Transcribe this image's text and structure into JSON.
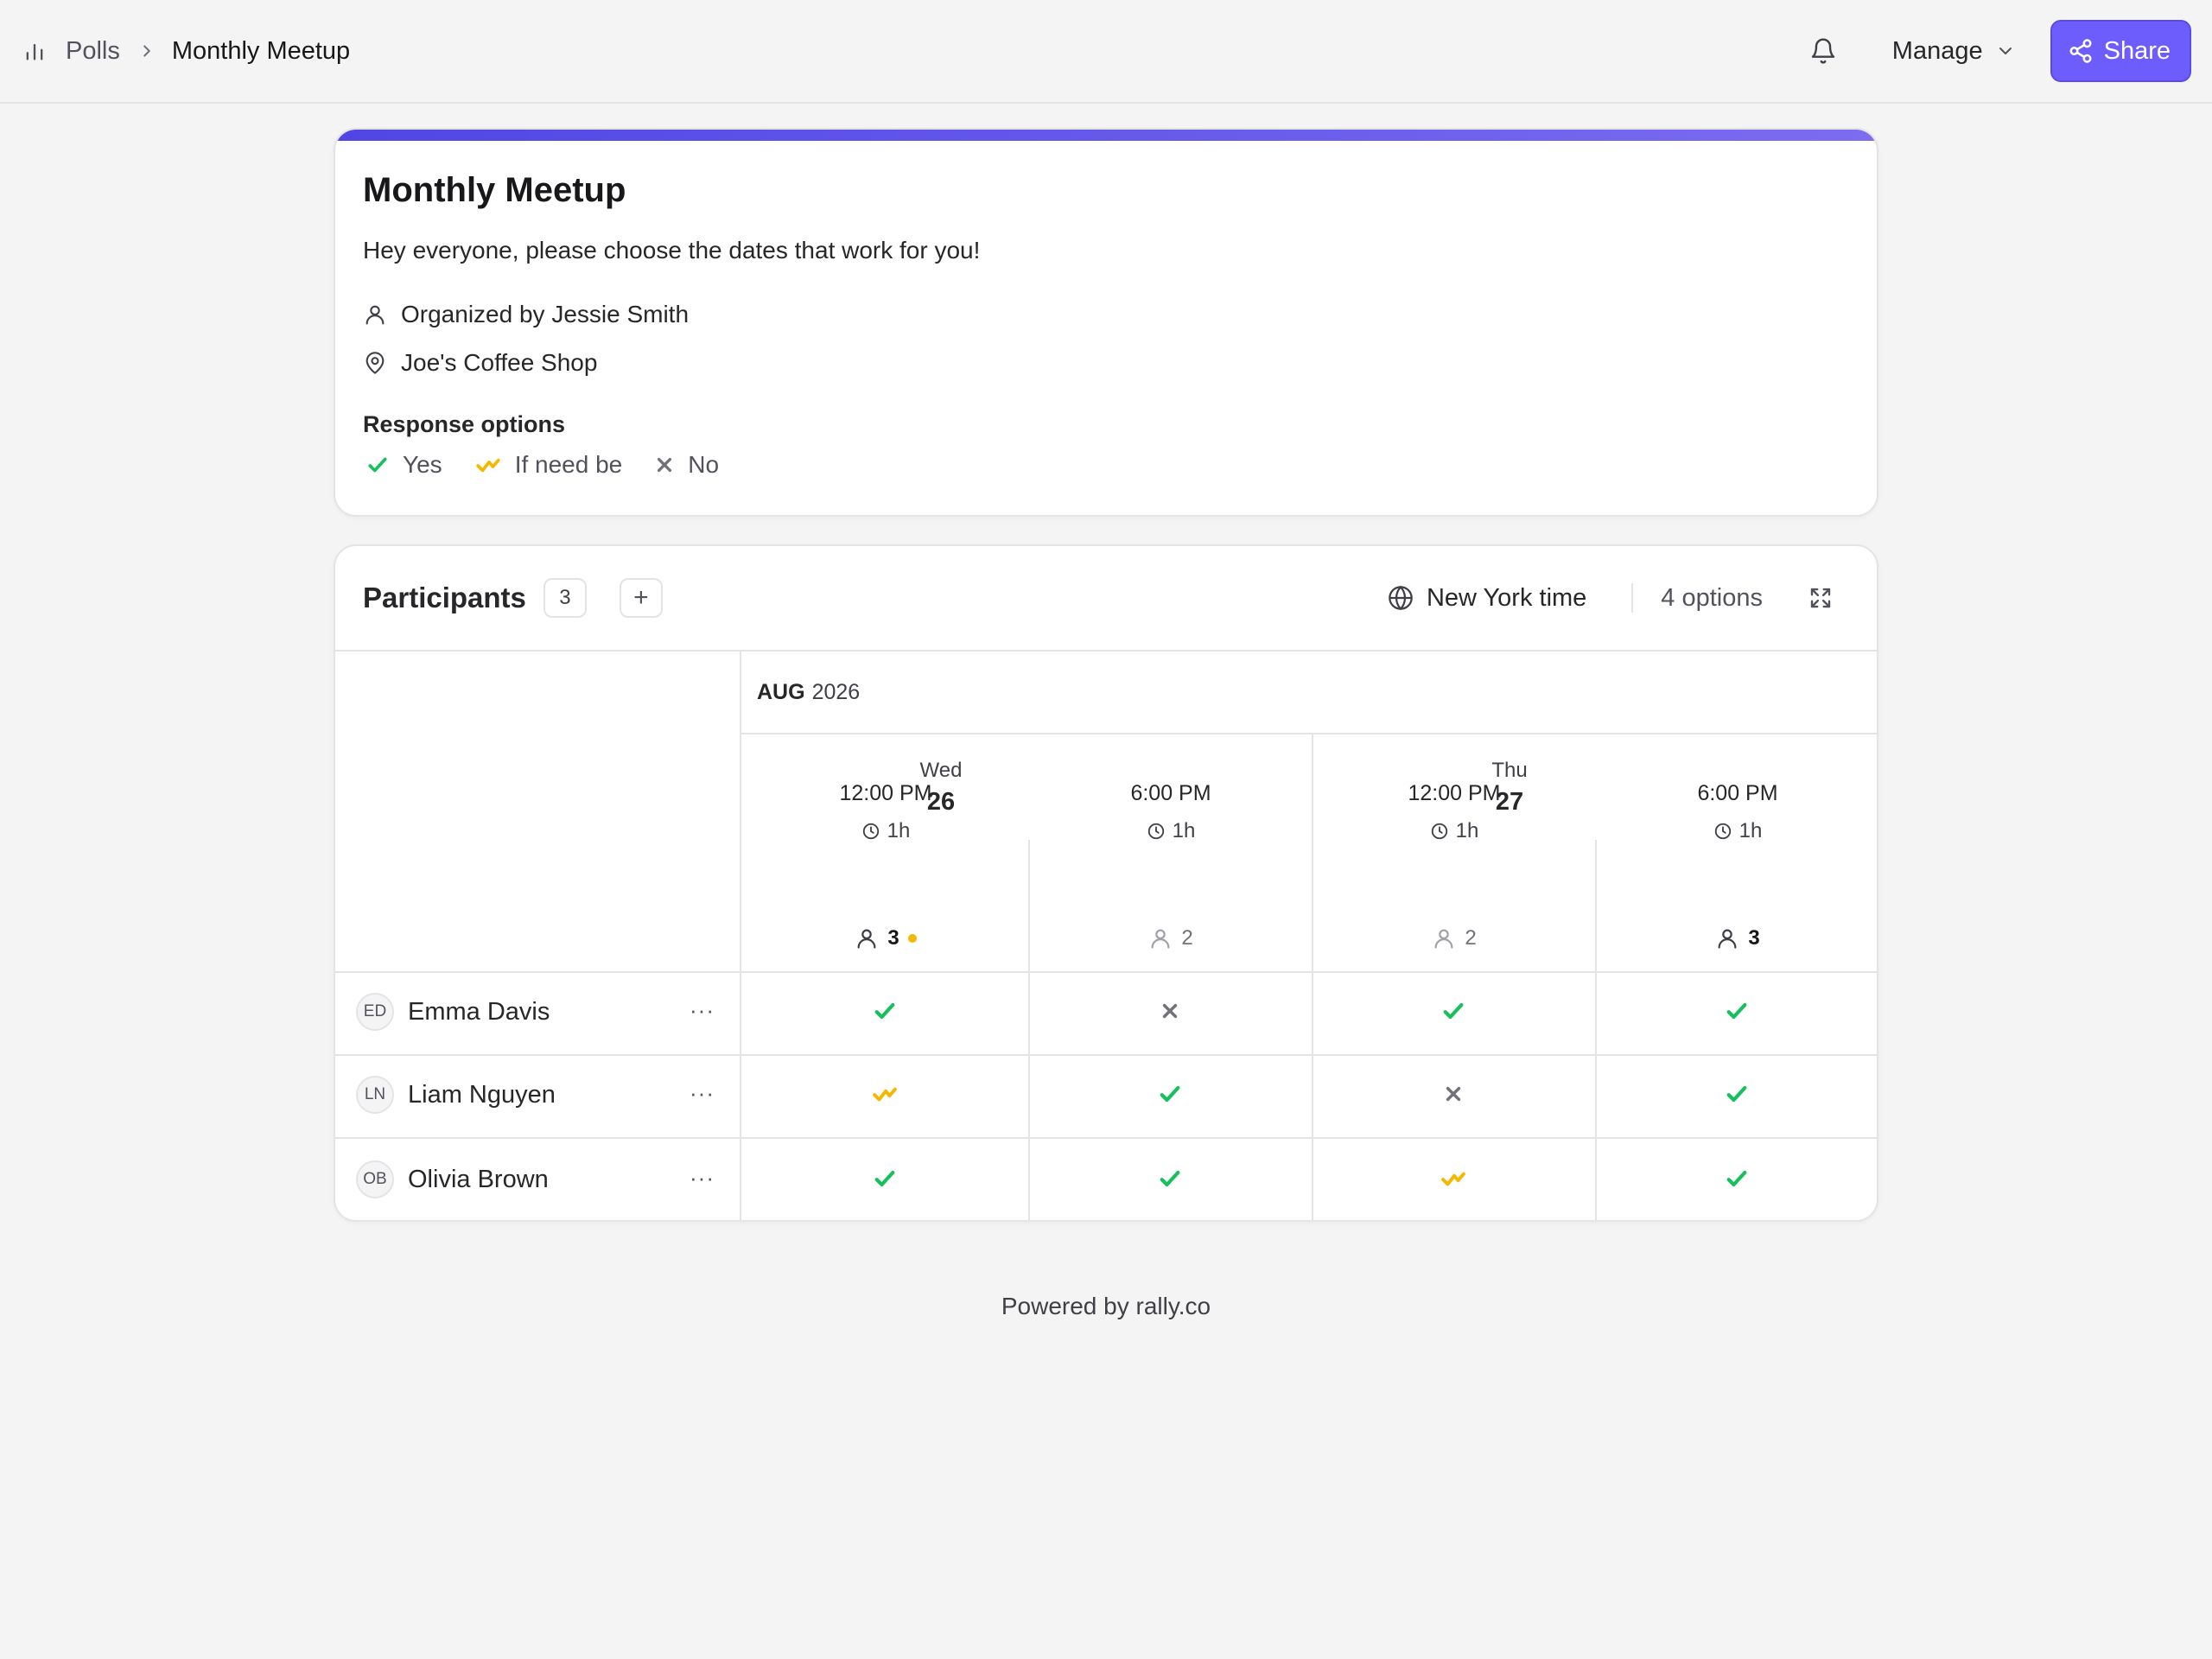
{
  "breadcrumb": {
    "root": "Polls",
    "current": "Monthly Meetup"
  },
  "header": {
    "manage_label": "Manage",
    "share_label": "Share"
  },
  "poll": {
    "title": "Monthly Meetup",
    "description": "Hey everyone, please choose the dates that work for you!",
    "organizer": "Organized by Jessie Smith",
    "location": "Joe's Coffee Shop"
  },
  "response_options": {
    "heading": "Response options",
    "yes": "Yes",
    "if_need_be": "If need be",
    "no": "No"
  },
  "participants": {
    "heading": "Participants",
    "count": "3",
    "add_label": "+",
    "timezone": "New York time",
    "options_count": "4 options"
  },
  "grid": {
    "month": "AUG",
    "year": "2026",
    "dates": [
      {
        "dow": "Wed",
        "day": "26"
      },
      {
        "dow": "Thu",
        "day": "27"
      }
    ],
    "columns": [
      {
        "time": "12:00 PM",
        "duration": "1h",
        "votes": "3"
      },
      {
        "time": "6:00 PM",
        "duration": "1h",
        "votes": "2"
      },
      {
        "time": "12:00 PM",
        "duration": "1h",
        "votes": "2"
      },
      {
        "time": "6:00 PM",
        "duration": "1h",
        "votes": "3"
      }
    ],
    "rows": [
      {
        "initials": "ED",
        "name": "Emma Davis",
        "more": "···",
        "votes": [
          "yes",
          "no",
          "yes",
          "yes"
        ]
      },
      {
        "initials": "LN",
        "name": "Liam Nguyen",
        "more": "···",
        "votes": [
          "ifneedbe",
          "yes",
          "no",
          "yes"
        ]
      },
      {
        "initials": "OB",
        "name": "Olivia Brown",
        "more": "···",
        "votes": [
          "yes",
          "yes",
          "ifneedbe",
          "yes"
        ]
      }
    ]
  },
  "footer": "Powered by rally.co",
  "colors": {
    "accent": "#6d5dfc",
    "yes": "#16c05a",
    "ifneedbe": "#f5b800",
    "no": "#71717a"
  }
}
